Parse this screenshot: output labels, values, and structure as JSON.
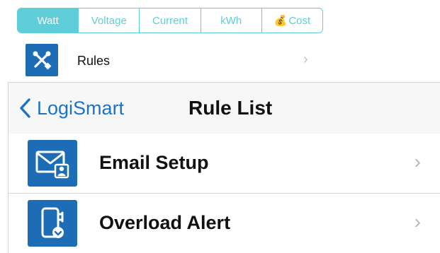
{
  "tabs": [
    {
      "label": "Watt",
      "active": true
    },
    {
      "label": "Voltage",
      "active": false
    },
    {
      "label": "Current",
      "active": false
    },
    {
      "label": "kWh",
      "active": false
    },
    {
      "label": "Cost",
      "active": false,
      "icon": "money-bag-icon"
    }
  ],
  "rules_row": {
    "label": "Rules",
    "icon": "tools-icon"
  },
  "navbar": {
    "back_label": "LogiSmart",
    "title": "Rule List"
  },
  "list": [
    {
      "label": "Email Setup",
      "icon": "email-user-icon"
    },
    {
      "label": "Overload Alert",
      "icon": "plug-alert-icon"
    }
  ],
  "colors": {
    "accent": "#5fcdd8",
    "icon_bg": "#1c6db6",
    "link": "#1b73c6"
  }
}
